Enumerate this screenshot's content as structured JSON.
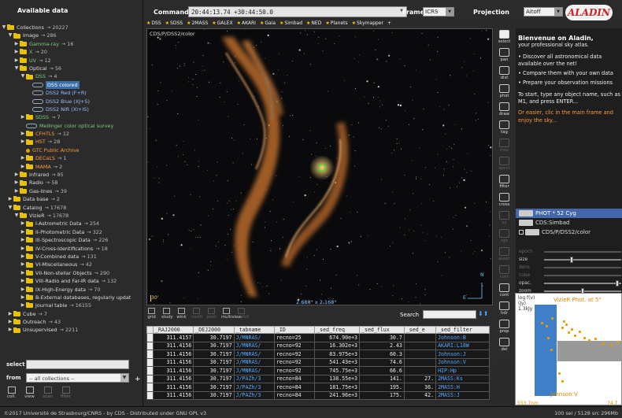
{
  "left": {
    "header": "Available data",
    "tree": [
      {
        "t": "▼",
        "k": "fd",
        "label": "Collections",
        "count": "→ 20227",
        "c": ""
      },
      {
        "t": "▼",
        "k": "fd",
        "label": "Image",
        "count": "→ 286",
        "c": "",
        "i": 1
      },
      {
        "t": "▶",
        "k": "fd",
        "label": "Gamma-ray",
        "count": "→ 16",
        "c": "g",
        "i": 2
      },
      {
        "t": "▶",
        "k": "fd",
        "label": "X",
        "count": "→ 20",
        "c": "g",
        "i": 2
      },
      {
        "t": "▶",
        "k": "fd",
        "label": "UV",
        "count": "→ 12",
        "c": "g",
        "i": 2
      },
      {
        "t": "▼",
        "k": "fd",
        "label": "Optical",
        "count": "→ 56",
        "c": "",
        "i": 2
      },
      {
        "t": "▼",
        "k": "fd",
        "label": "DSS",
        "count": "→ 4",
        "c": "g",
        "i": 3
      },
      {
        "t": "",
        "k": "ic",
        "label": "DSS colored",
        "count": "",
        "c": "sel",
        "i": 4
      },
      {
        "t": "",
        "k": "ic",
        "label": "DSS2 Red (F+R)",
        "count": "",
        "c": "b",
        "i": 4
      },
      {
        "t": "",
        "k": "ic",
        "label": "DSS2 Blue (XJ+S)",
        "count": "",
        "c": "b",
        "i": 4
      },
      {
        "t": "",
        "k": "ic",
        "label": "DSS2 NIR (XI+IS)",
        "count": "",
        "c": "b",
        "i": 4
      },
      {
        "t": "▶",
        "k": "fd",
        "label": "SDSS",
        "count": "→ 7",
        "c": "g",
        "i": 3
      },
      {
        "t": "",
        "k": "ic",
        "label": "Mellinger color optical survey",
        "count": "",
        "c": "g",
        "i": 3
      },
      {
        "t": "▶",
        "k": "fd",
        "label": "CFHTLS",
        "count": "→ 12",
        "c": "o",
        "i": 3
      },
      {
        "t": "▶",
        "k": "fd",
        "label": "HST",
        "count": "→ 28",
        "c": "o",
        "i": 3
      },
      {
        "t": "",
        "k": "dot",
        "label": "GTC Public Archive",
        "count": "",
        "c": "o",
        "i": 3
      },
      {
        "t": "▶",
        "k": "fd",
        "label": "DECaLS",
        "count": "→ 1",
        "c": "o",
        "i": 3
      },
      {
        "t": "▶",
        "k": "fd",
        "label": "MAMA",
        "count": "→ 2",
        "c": "o",
        "i": 3
      },
      {
        "t": "▶",
        "k": "fd",
        "label": "Infrared",
        "count": "→ 85",
        "c": "",
        "i": 2
      },
      {
        "t": "▶",
        "k": "fd",
        "label": "Radio",
        "count": "→ 58",
        "c": "",
        "i": 2
      },
      {
        "t": "▶",
        "k": "fd",
        "label": "Gas-lines",
        "count": "→ 39",
        "c": "",
        "i": 2
      },
      {
        "t": "▶",
        "k": "fd",
        "label": "Data base",
        "count": "→ 2",
        "c": "",
        "i": 1
      },
      {
        "t": "▼",
        "k": "fd",
        "label": "Catalog",
        "count": "→ 17678",
        "c": "",
        "i": 1
      },
      {
        "t": "▼",
        "k": "fd",
        "label": "VizieR",
        "count": "→ 17678",
        "c": "",
        "i": 2
      },
      {
        "t": "▶",
        "k": "fd",
        "label": "I-Astrometric Data",
        "count": "→ 254",
        "c": "",
        "i": 3
      },
      {
        "t": "▶",
        "k": "fd",
        "label": "II-Photometric Data",
        "count": "→ 322",
        "c": "",
        "i": 3
      },
      {
        "t": "▶",
        "k": "fd",
        "label": "III-Spectroscopic Data",
        "count": "→ 226",
        "c": "",
        "i": 3
      },
      {
        "t": "▶",
        "k": "fd",
        "label": "IV-Cross-Identifications",
        "count": "→ 18",
        "c": "",
        "i": 3
      },
      {
        "t": "▶",
        "k": "fd",
        "label": "V-Combined data",
        "count": "→ 131",
        "c": "",
        "i": 3
      },
      {
        "t": "▶",
        "k": "fd",
        "label": "VI-Miscellaneous",
        "count": "→ 42",
        "c": "",
        "i": 3
      },
      {
        "t": "▶",
        "k": "fd",
        "label": "VII-Non-stellar Objects",
        "count": "→ 290",
        "c": "",
        "i": 3
      },
      {
        "t": "▶",
        "k": "fd",
        "label": "VIII-Radio and Far-IR data",
        "count": "→ 132",
        "c": "",
        "i": 3
      },
      {
        "t": "▶",
        "k": "fd",
        "label": "IX-High-Energy data",
        "count": "→ 70",
        "c": "",
        "i": 3
      },
      {
        "t": "▶",
        "k": "fd",
        "label": "B-External databases, regularly updat",
        "count": "",
        "c": "",
        "i": 3
      },
      {
        "t": "▶",
        "k": "fd",
        "label": "Journal table",
        "count": "→ 16155",
        "c": "",
        "i": 3
      },
      {
        "t": "▶",
        "k": "fd",
        "label": "Cube",
        "count": "→ 7",
        "c": "",
        "i": 1
      },
      {
        "t": "▶",
        "k": "fd",
        "label": "Outreach",
        "count": "→ 43",
        "c": "",
        "i": 1
      },
      {
        "t": "▶",
        "k": "fd",
        "label": "Unsupervised",
        "count": "→ 2211",
        "c": "",
        "i": 1
      }
    ],
    "select_label": "select",
    "from_label": "from",
    "from_value": "-- all collections --",
    "buttons": [
      {
        "label": "coll.",
        "dim": false
      },
      {
        "label": "view",
        "dim": false
      },
      {
        "label": "scan",
        "dim": true
      },
      {
        "label": "filter",
        "dim": true
      }
    ]
  },
  "top": {
    "command_label": "Command",
    "command_value": "20:44:13.74 +30:44:50.0",
    "frame_label": "Frame",
    "frame_value": "ICRS",
    "projection_label": "Projection",
    "projection_value": "Aitoff",
    "logo": "ALADIN",
    "surveys": [
      "DSS",
      "SDSS",
      "2MASS",
      "GALEX",
      "AKARI",
      "Gaia",
      "Simbad",
      "NED",
      "Planets",
      "Skymapper"
    ],
    "surveys_plus": "+"
  },
  "view": {
    "label": "CDS/P/DSS2/color",
    "fov": "2.688° x 2.168°",
    "scale": "30'",
    "compass_n": "N",
    "compass_e": "E"
  },
  "tools": [
    {
      "label": "select",
      "act": true
    },
    {
      "label": "pan"
    },
    {
      "label": "dist"
    },
    {
      "label": "phot"
    },
    {
      "label": "draw"
    },
    {
      "label": "tag"
    },
    {
      "label": "moc",
      "dis": true
    },
    {
      "label": "spect",
      "dis": true
    },
    {
      "label": "filter"
    },
    {
      "label": "cross"
    },
    {
      "label": "xy",
      "dis": true
    },
    {
      "label": "rgb",
      "dis": true
    },
    {
      "label": "assoc",
      "dis": true
    },
    {
      "label": "cont",
      "dis": true
    },
    {
      "label": "cont"
    },
    {
      "label": "hdr"
    },
    {
      "label": "prop"
    },
    {
      "label": "del"
    }
  ],
  "welcome": {
    "title": "Bienvenue on Aladin,",
    "sub": "your professional sky atlas.",
    "bullets": [
      "Discover all astronomical data available over the net!",
      "Compare them with your own data",
      "Prepare your observation missions"
    ],
    "p1": "To start, type any object name, such as M1, and press ENTER...",
    "p2": "Or easier, clic in the main frame and enjoy the sky..."
  },
  "layers": [
    {
      "label": "PHOT * 52 Cyg",
      "hl": true
    },
    {
      "label": "CDS:Simbad"
    },
    {
      "label": "CDS/P/DSS2/color",
      "ck": true
    }
  ],
  "sliders": [
    {
      "label": "epoch",
      "dis": true,
      "v": 0.0
    },
    {
      "label": "size",
      "v": 0.35
    },
    {
      "label": "dens",
      "dis": true,
      "v": 0.0
    },
    {
      "label": "cube",
      "dis": true,
      "v": 0.0
    },
    {
      "label": "opac.",
      "v": 0.97
    },
    {
      "label": "zoom",
      "v": 0.5
    }
  ],
  "tablebar": [
    {
      "label": "grid"
    },
    {
      "label": "study"
    },
    {
      "label": "wink"
    },
    {
      "label": "north",
      "dis": true
    },
    {
      "label": "pixel",
      "dis": true
    },
    {
      "label": "multiview"
    },
    {
      "label": "match",
      "dis": true
    }
  ],
  "search_label": "Search",
  "table": {
    "headers": [
      "_RAJ2000",
      "_DEJ2000",
      "_tabname",
      "_ID",
      "_sed_freq",
      "_sed_flux",
      "_sed_e",
      "_sed_filter"
    ],
    "rows": [
      [
        "311.4157",
        "30.7197",
        "J/MNRAS/",
        "recno=25",
        "674.90e+3",
        "30.7",
        "",
        "Johnson:B"
      ],
      [
        "311.4156",
        "30.7197",
        "J/MNRAS/",
        "recno=92",
        "16.302e+3",
        "2.43",
        "",
        "AKARI:L18W"
      ],
      [
        "311.4156",
        "30.7197",
        "J/MNRAS/",
        "recno=92",
        "83.975e+3",
        "60.3",
        "",
        "Johnson:J"
      ],
      [
        "311.4156",
        "30.7197",
        "J/MNRAS/",
        "recno=92",
        "541.43e+3",
        "74.6",
        "",
        "Johnson:V"
      ],
      [
        "311.4156",
        "30.7197",
        "J/MNRAS/",
        "recno=92",
        "745.75e+3",
        "66.6",
        "",
        "HIP:Hp"
      ],
      [
        "311.4156",
        "30.7197",
        "J/PAZh/3",
        "recno=84",
        "138.55e+3",
        "141.",
        "27.",
        "2MASS:Ks"
      ],
      [
        "311.4156",
        "30.7197",
        "J/PAZh/3",
        "recno=84",
        "181.75e+3",
        "195.",
        "36.",
        "2MASS:H"
      ],
      [
        "311.4156",
        "30.7197",
        "J/PAZh/3",
        "recno=84",
        "241.96e+3",
        "175.",
        "42.",
        "2MASS:J"
      ]
    ]
  },
  "plot": {
    "ylabel": "log f(v)",
    "yunit": "(Jy)",
    "ysub": "1.3kJy",
    "title": "VizieR Phot. at 5\"",
    "xlabel": "Johnson:V",
    "xa": "553.7nm",
    "xb": "74.7"
  },
  "status": {
    "left": "©2017 Université de Strasbourg/CNRS - by CDS - Distributed under GNU GPL v3",
    "right": "100 sel / 5128 src    296Mb"
  }
}
